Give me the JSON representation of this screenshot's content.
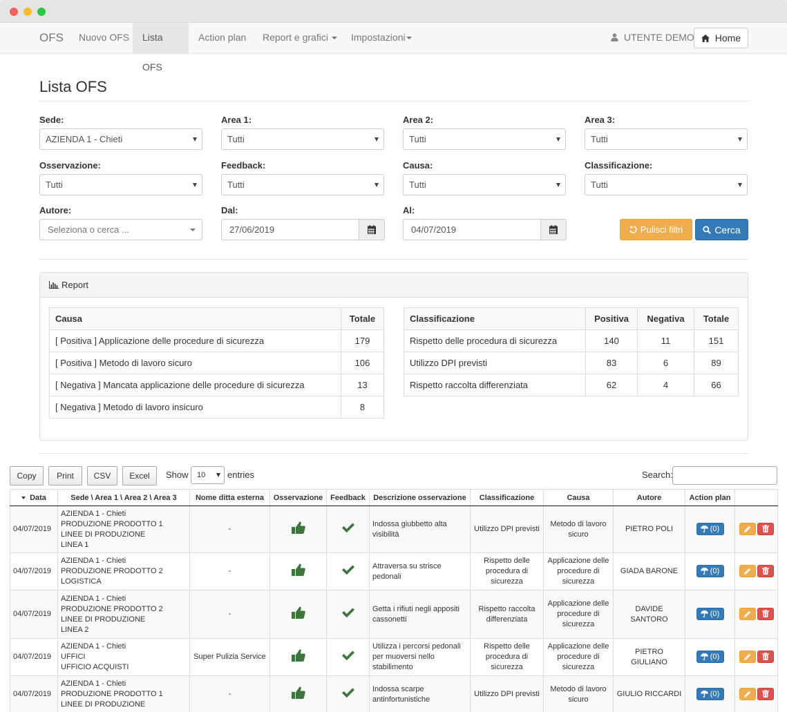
{
  "nav": {
    "brand": "OFS",
    "items": [
      {
        "label": "Nuovo OFS",
        "active": false,
        "dropdown": false
      },
      {
        "label": "Lista OFS",
        "active": true,
        "dropdown": false
      },
      {
        "label": "Action plan",
        "active": false,
        "dropdown": false
      },
      {
        "label": "Report e grafici",
        "active": false,
        "dropdown": true
      },
      {
        "label": "Impostazioni",
        "active": false,
        "dropdown": true
      }
    ],
    "user": "UTENTE DEMO",
    "home_label": "Home"
  },
  "page_title": "Lista OFS",
  "filters": {
    "sede": {
      "label": "Sede:",
      "value": "AZIENDA 1 - Chieti"
    },
    "area1": {
      "label": "Area 1:",
      "value": "Tutti"
    },
    "area2": {
      "label": "Area 2:",
      "value": "Tutti"
    },
    "area3": {
      "label": "Area 3:",
      "value": "Tutti"
    },
    "osservazione": {
      "label": "Osservazione:",
      "value": "Tutti"
    },
    "feedback": {
      "label": "Feedback:",
      "value": "Tutti"
    },
    "causa": {
      "label": "Causa:",
      "value": "Tutti"
    },
    "classificazione": {
      "label": "Classificazione:",
      "value": "Tutti"
    },
    "autore": {
      "label": "Autore:",
      "placeholder": "Seleziona o cerca ..."
    },
    "dal": {
      "label": "Dal:",
      "value": "27/06/2019"
    },
    "al": {
      "label": "Al:",
      "value": "04/07/2019"
    },
    "clear_label": "Pulisci filtri",
    "search_label": "Cerca"
  },
  "report": {
    "heading": "Report",
    "causa_table": {
      "headers": [
        "Causa",
        "Totale"
      ],
      "rows": [
        [
          "[ Positiva ] Applicazione delle procedure di sicurezza",
          "179"
        ],
        [
          "[ Positiva ] Metodo di lavoro sicuro",
          "106"
        ],
        [
          "[ Negativa ] Mancata applicazione delle procedure di sicurezza",
          "13"
        ],
        [
          "[ Negativa ] Metodo di lavoro insicuro",
          "8"
        ]
      ]
    },
    "class_table": {
      "headers": [
        "Classificazione",
        "Positiva",
        "Negativa",
        "Totale"
      ],
      "rows": [
        [
          "Rispetto delle procedura di sicurezza",
          "140",
          "11",
          "151"
        ],
        [
          "Utilizzo DPI previsti",
          "83",
          "6",
          "89"
        ],
        [
          "Rispetto raccolta differenziata",
          "62",
          "4",
          "66"
        ]
      ]
    }
  },
  "datatable": {
    "buttons": [
      "Copy",
      "Print",
      "CSV",
      "Excel"
    ],
    "show_label": "Show",
    "length": "10",
    "entries_label": "entries",
    "search_label": "Search:",
    "headers": [
      "Data",
      "Sede \\ Area 1 \\ Area 2 \\ Area 3",
      "Nome ditta esterna",
      "Osservazione",
      "Feedback",
      "Descrizione osservazione",
      "Classificazione",
      "Causa",
      "Autore",
      "Action plan",
      ""
    ],
    "rows": [
      {
        "data": "04/07/2019",
        "sede": [
          "AZIENDA 1 - Chieti",
          "PRODUZIONE PRODOTTO 1",
          "LINEE DI PRODUZIONE",
          "LINEA 1"
        ],
        "ditta": "-",
        "descrizione": "Indossa giubbetto alta visibilità",
        "classificazione": "Utilizzo DPI previsti",
        "causa": "Metodo di lavoro sicuro",
        "autore": "PIETRO POLI",
        "action_count": "(0)"
      },
      {
        "data": "04/07/2019",
        "sede": [
          "AZIENDA 1 - Chieti",
          "PRODUZIONE PRODOTTO 2",
          "LOGISTICA"
        ],
        "ditta": "-",
        "descrizione": "Attraversa su strisce pedonali",
        "classificazione": "Rispetto delle procedura di sicurezza",
        "causa": "Applicazione delle procedure di sicurezza",
        "autore": "GIADA BARONE",
        "action_count": "(0)"
      },
      {
        "data": "04/07/2019",
        "sede": [
          "AZIENDA 1 - Chieti",
          "PRODUZIONE PRODOTTO 2",
          "LINEE DI PRODUZIONE",
          "LINEA 2"
        ],
        "ditta": "-",
        "descrizione": "Getta i rifiuti negli appositi cassonetti",
        "classificazione": "Rispetto raccolta differenziata",
        "causa": "Applicazione delle procedure di sicurezza",
        "autore": "DAVIDE SANTORO",
        "action_count": "(0)"
      },
      {
        "data": "04/07/2019",
        "sede": [
          "AZIENDA 1 - Chieti",
          "UFFICI",
          "UFFICIO ACQUISTI"
        ],
        "ditta": "Super Pulizia Service",
        "descrizione": "Utilizza i percorsi pedonali per muoversi nello stabilimento",
        "classificazione": "Rispetto delle procedura di sicurezza",
        "causa": "Applicazione delle procedure di sicurezza",
        "autore": "PIETRO GIULIANO",
        "action_count": "(0)"
      },
      {
        "data": "04/07/2019",
        "sede": [
          "AZIENDA 1 - Chieti",
          "PRODUZIONE PRODOTTO 1",
          "LINEE DI PRODUZIONE"
        ],
        "ditta": "-",
        "descrizione": "Indossa scarpe antinfortunistiche",
        "classificazione": "Utilizzo DPI previsti",
        "causa": "Metodo di lavoro sicuro",
        "autore": "GIULIO RICCARDI",
        "action_count": "(0)"
      }
    ]
  },
  "icons": {
    "user": "user-icon",
    "home": "home-icon",
    "calendar": "calendar-icon",
    "undo": "undo-icon",
    "search": "search-icon",
    "chart": "bar-chart-icon",
    "thumbs_up": "thumbs-up-icon",
    "check": "check-icon",
    "umbrella": "umbrella-icon",
    "pencil": "pencil-icon",
    "trash": "trash-icon"
  },
  "colors": {
    "primary": "#337ab7",
    "warning": "#f0ad4e",
    "danger": "#d9534f",
    "success_icon": "#3c763d"
  }
}
